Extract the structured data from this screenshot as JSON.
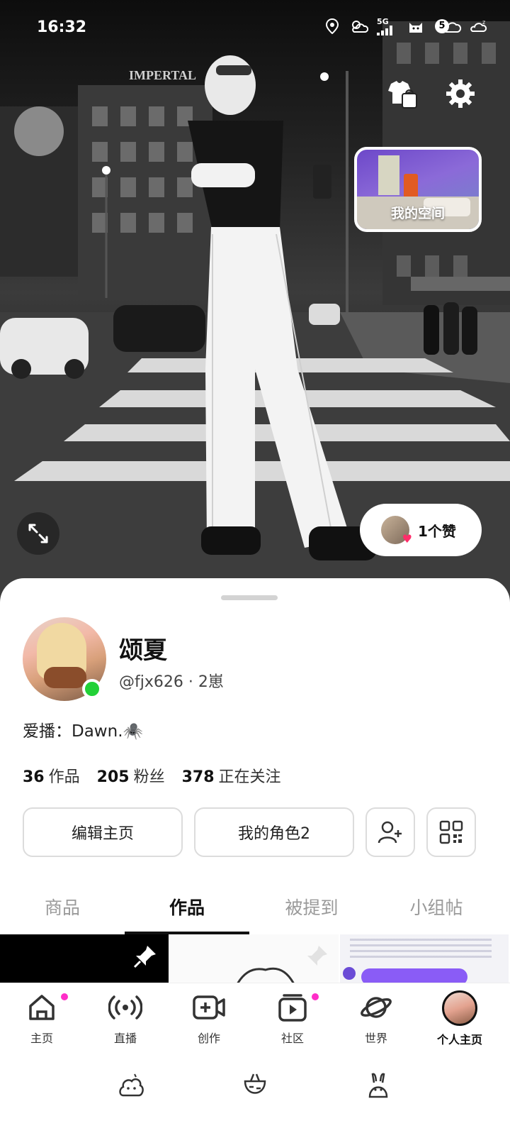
{
  "status_bar": {
    "time": "16:32",
    "network": "5G",
    "battery_level": "5"
  },
  "hero": {
    "sign_text": "IMPERTAL",
    "space_card_label": "我的空间",
    "likes_label": "1个赞"
  },
  "profile": {
    "name": "颂夏",
    "handle": "@fjx626 · 2崽",
    "bio": "爱播：Dawn.🕷️",
    "stats": [
      {
        "value": "36",
        "label": "作品"
      },
      {
        "value": "205",
        "label": "粉丝"
      },
      {
        "value": "378",
        "label": "正在关注"
      }
    ],
    "buttons": {
      "edit": "编辑主页",
      "roles": "我的角色2"
    }
  },
  "tabs": [
    {
      "label": "商品",
      "active": false
    },
    {
      "label": "作品",
      "active": true
    },
    {
      "label": "被提到",
      "active": false
    },
    {
      "label": "小组帖",
      "active": false
    }
  ],
  "bottom_nav": [
    {
      "label": "主页",
      "icon": "home-icon",
      "dot": true
    },
    {
      "label": "直播",
      "icon": "live-icon",
      "dot": false
    },
    {
      "label": "创作",
      "icon": "create-icon",
      "dot": false
    },
    {
      "label": "社区",
      "icon": "community-icon",
      "dot": true
    },
    {
      "label": "世界",
      "icon": "world-icon",
      "dot": false
    },
    {
      "label": "个人主页",
      "icon": "profile-avatar",
      "dot": false,
      "active": true
    }
  ],
  "colors": {
    "online": "#22d137",
    "notification_dot": "#ff2dc8",
    "like_heart": "#ff2d6a"
  }
}
